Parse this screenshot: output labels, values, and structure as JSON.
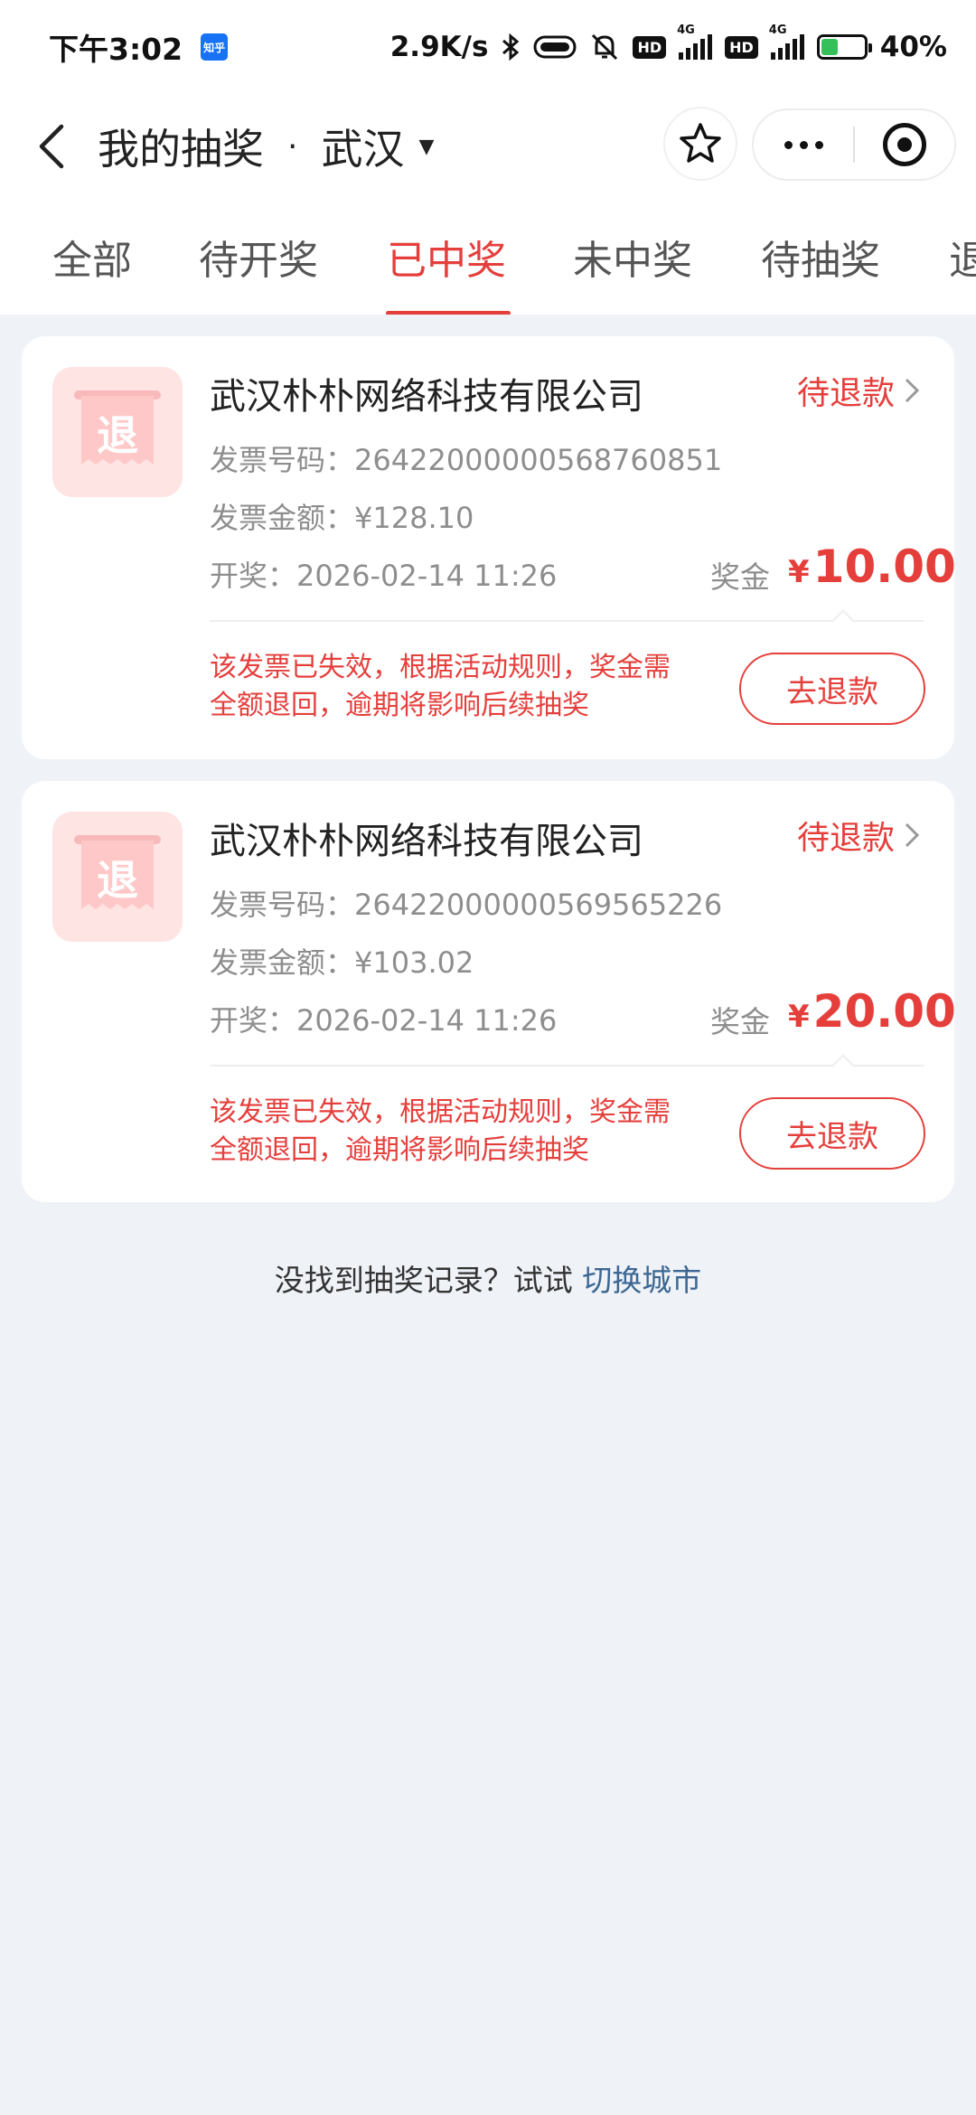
{
  "status_bar": {
    "time": "下午3:02",
    "app_badge": "知乎",
    "net_speed": "2.9K/s",
    "hd1": "HD",
    "hd2": "HD",
    "net1": "4G",
    "net2": "4G",
    "battery": "40%",
    "battery_level": 0.4
  },
  "nav": {
    "title": "我的抽奖",
    "separator": "·",
    "city": "武汉",
    "caret": "▼"
  },
  "tabs": [
    {
      "label": "全部"
    },
    {
      "label": "待开奖"
    },
    {
      "label": "已中奖"
    },
    {
      "label": "未中奖"
    },
    {
      "label": "待抽奖"
    },
    {
      "label": "退"
    }
  ],
  "icon_char": "退",
  "cards": [
    {
      "company": "武汉朴朴网络科技有限公司",
      "status": "待退款",
      "invoice_no_label": "发票号码：",
      "invoice_no": "26422000000568760851",
      "invoice_amount_label": "发票金额：",
      "invoice_amount": "¥128.10",
      "draw_label": "开奖：",
      "draw_time": "2026-02-14 11:26",
      "prize_label": "奖金",
      "prize_currency": "¥",
      "prize_amount": "10.00",
      "notice_line1": "该发票已失效，根据活动规则，奖金需",
      "notice_line2": "全额退回，逾期将影响后续抽奖",
      "button": "去退款"
    },
    {
      "company": "武汉朴朴网络科技有限公司",
      "status": "待退款",
      "invoice_no_label": "发票号码：",
      "invoice_no": "26422000000569565226",
      "invoice_amount_label": "发票金额：",
      "invoice_amount": "¥103.02",
      "draw_label": "开奖：",
      "draw_time": "2026-02-14 11:26",
      "prize_label": "奖金",
      "prize_currency": "¥",
      "prize_amount": "20.00",
      "notice_line1": "该发票已失效，根据活动规则，奖金需",
      "notice_line2": "全额退回，逾期将影响后续抽奖",
      "button": "去退款"
    }
  ],
  "footer": {
    "hint": "没找到抽奖记录？试试 ",
    "link": "切换城市"
  },
  "colors": {
    "accent": "#e53f3c",
    "link": "#3c6792",
    "page_bg": "#eff2f7"
  }
}
